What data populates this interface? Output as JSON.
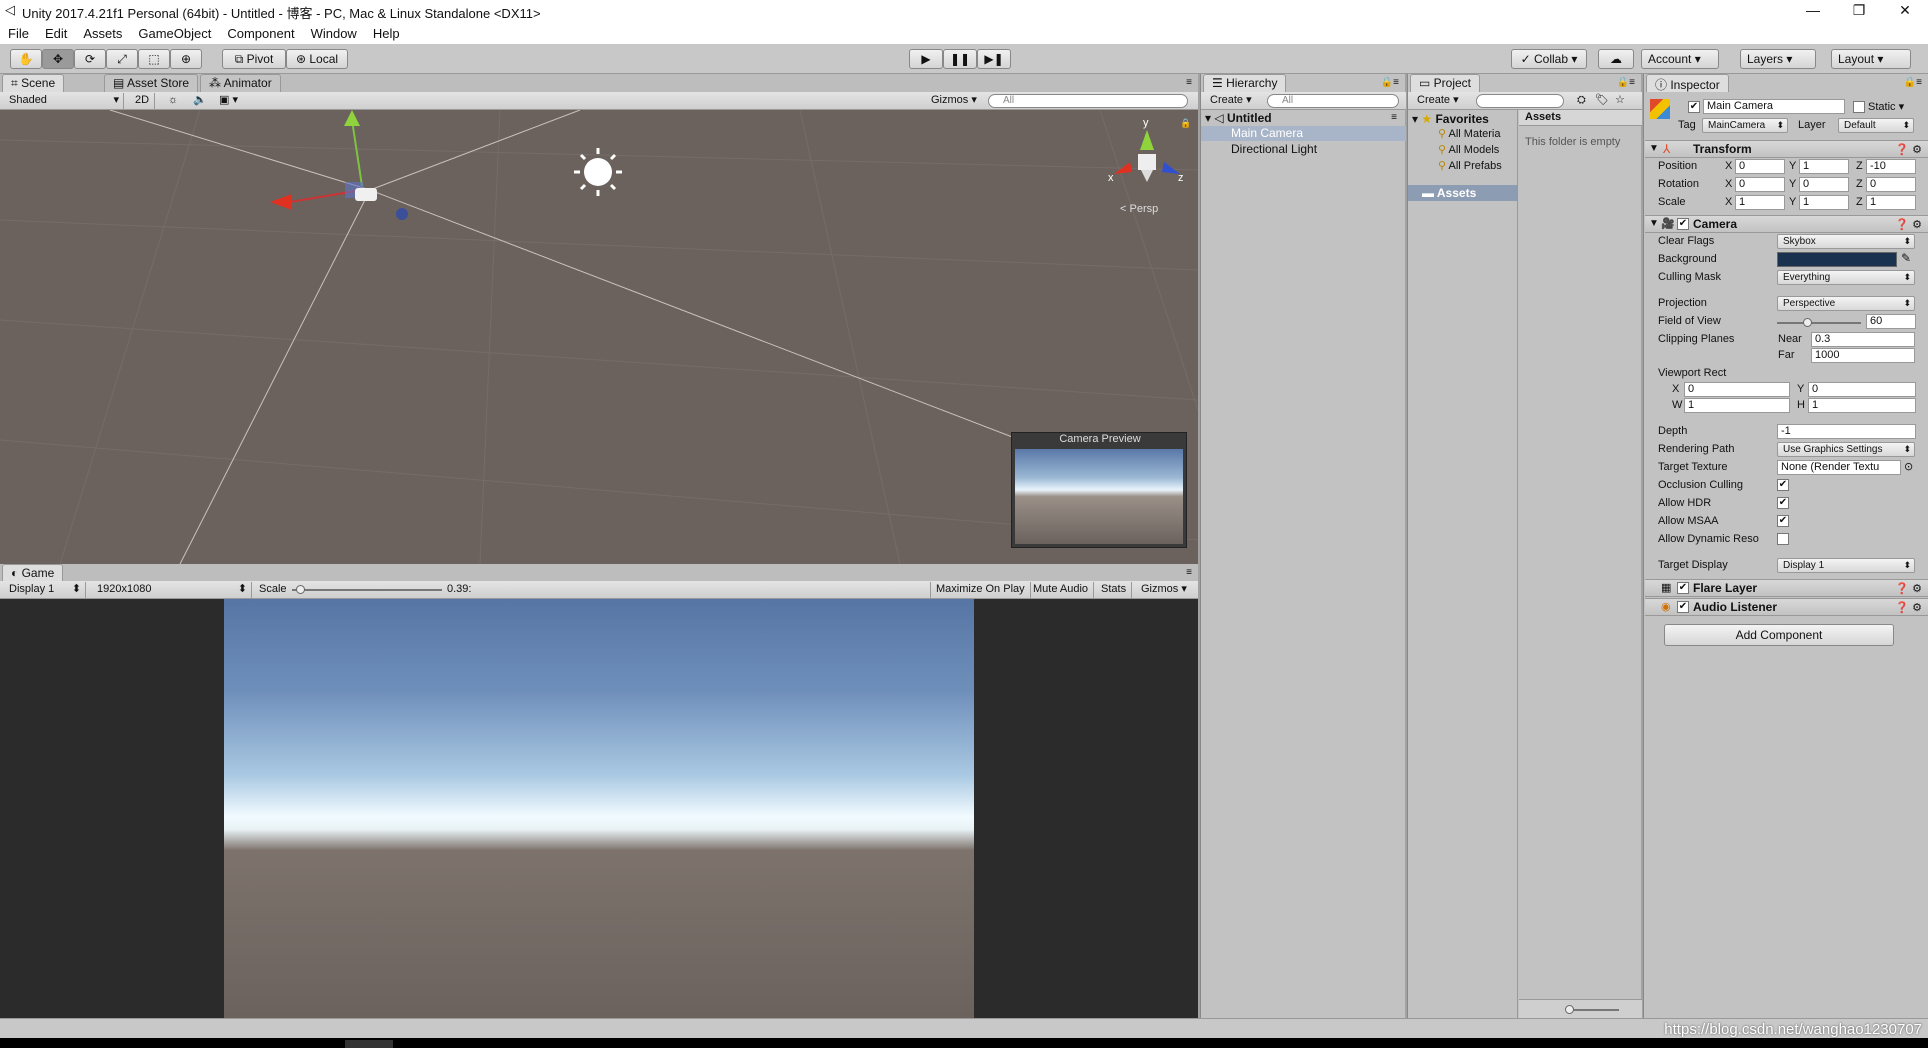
{
  "window": {
    "title": "Unity 2017.4.21f1 Personal (64bit) - Untitled - 博客 - PC, Mac & Linux Standalone <DX11>",
    "minimize": "—",
    "maximize": "❐",
    "close": "✕"
  },
  "menu": [
    "File",
    "Edit",
    "Assets",
    "GameObject",
    "Component",
    "Window",
    "Help"
  ],
  "toolbar": {
    "tools": [
      "✋",
      "✥",
      "⟳",
      "⤢",
      "⬚",
      "⊕"
    ],
    "pivot": "Pivot",
    "local": "Local",
    "play": "▶",
    "pause": "❚❚",
    "step": "▶❚",
    "collab": "Collab",
    "cloud": "☁",
    "account": "Account",
    "layers": "Layers",
    "layout": "Layout"
  },
  "scene": {
    "tabs": {
      "scene": "Scene",
      "asset_store": "Asset Store",
      "animator": "Animator"
    },
    "shading": "Shaded",
    "mode2d": "2D",
    "gizmos": "Gizmos",
    "search": "All",
    "persp": "Persp",
    "axes": {
      "y": "y",
      "x": "x",
      "z": "z"
    },
    "camera_preview": "Camera Preview"
  },
  "game": {
    "tab": "Game",
    "display": "Display 1",
    "resolution": "1920x1080",
    "scale_label": "Scale",
    "scale_value": "0.39:",
    "scale_fraction": 0.05,
    "maximize": "Maximize On Play",
    "mute": "Mute Audio",
    "stats": "Stats",
    "gizmos": "Gizmos"
  },
  "hierarchy": {
    "tab": "Hierarchy",
    "create": "Create",
    "search": "All",
    "scene": "Untitled",
    "items": [
      "Main Camera",
      "Directional Light"
    ]
  },
  "project": {
    "tab": "Project",
    "create": "Create",
    "favorites": "Favorites",
    "fav_items": [
      "All Materia",
      "All Models",
      "All Prefabs"
    ],
    "assets_root": "Assets",
    "assets_header": "Assets",
    "empty": "This folder is empty"
  },
  "inspector": {
    "tab": "Inspector",
    "name": "Main Camera",
    "static": "Static",
    "tag_label": "Tag",
    "tag": "MainCamera",
    "layer_label": "Layer",
    "layer": "Default",
    "transform": {
      "title": "Transform",
      "position": {
        "label": "Position",
        "x": "0",
        "y": "1",
        "z": "-10"
      },
      "rotation": {
        "label": "Rotation",
        "x": "0",
        "y": "0",
        "z": "0"
      },
      "scale": {
        "label": "Scale",
        "x": "1",
        "y": "1",
        "z": "1"
      }
    },
    "camera": {
      "title": "Camera",
      "clear_flags_label": "Clear Flags",
      "clear_flags": "Skybox",
      "background_label": "Background",
      "background_color": "#19324f",
      "culling_label": "Culling Mask",
      "culling": "Everything",
      "projection_label": "Projection",
      "projection": "Perspective",
      "fov_label": "Field of View",
      "fov": "60",
      "fov_fraction": 0.36,
      "clipping_label": "Clipping Planes",
      "near_label": "Near",
      "near": "0.3",
      "far_label": "Far",
      "far": "1000",
      "viewport_label": "Viewport Rect",
      "vx": "0",
      "vy": "0",
      "vw": "1",
      "vh": "1",
      "depth_label": "Depth",
      "depth": "-1",
      "rendering_label": "Rendering Path",
      "rendering": "Use Graphics Settings",
      "target_tex_label": "Target Texture",
      "target_tex": "None (Render Textu",
      "occlusion_label": "Occlusion Culling",
      "hdr_label": "Allow HDR",
      "msaa_label": "Allow MSAA",
      "dynres_label": "Allow Dynamic Reso",
      "target_display_label": "Target Display",
      "target_display": "Display 1"
    },
    "flare": "Flare Layer",
    "audio": "Audio Listener",
    "add_component": "Add Component"
  },
  "watermark": "https://blog.csdn.net/wanghao1230707"
}
